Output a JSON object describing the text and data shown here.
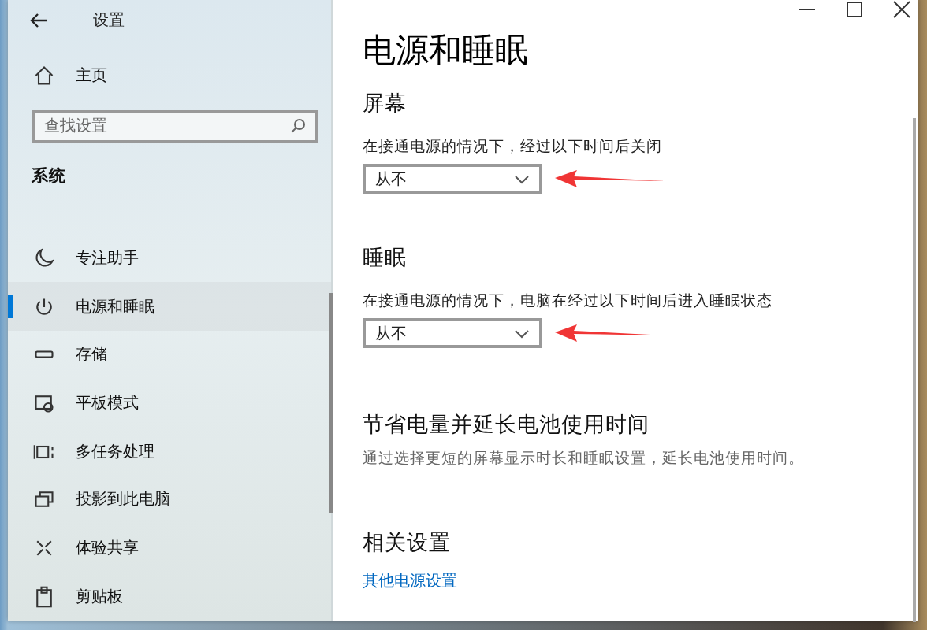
{
  "window": {
    "title": "设置"
  },
  "sidebar": {
    "home": "主页",
    "search": {
      "placeholder": "查找设置"
    },
    "section": "系统",
    "items": [
      {
        "label": "专注助手",
        "kind": "moon",
        "selected": false
      },
      {
        "label": "电源和睡眠",
        "kind": "power",
        "selected": true
      },
      {
        "label": "存储",
        "kind": "storage",
        "selected": false
      },
      {
        "label": "平板模式",
        "kind": "tablet",
        "selected": false
      },
      {
        "label": "多任务处理",
        "kind": "multitask",
        "selected": false
      },
      {
        "label": "投影到此电脑",
        "kind": "project",
        "selected": false
      },
      {
        "label": "体验共享",
        "kind": "share",
        "selected": false
      },
      {
        "label": "剪贴板",
        "kind": "clipboard",
        "selected": false
      }
    ]
  },
  "page": {
    "title": "电源和睡眠",
    "sections": [
      {
        "kind": "dropdown",
        "heading": "屏幕",
        "description": "在接通电源的情况下，经过以下时间后关闭",
        "value": "从不"
      },
      {
        "kind": "dropdown",
        "heading": "睡眠",
        "description": "在接通电源的情况下，电脑在经过以下时间后进入睡眠状态",
        "value": "从不"
      },
      {
        "kind": "text",
        "heading": "节省电量并延长电池使用时间",
        "description": "通过选择更短的屏幕显示时长和睡眠设置，延长电池使用时间。"
      },
      {
        "kind": "link",
        "heading": "相关设置",
        "link": "其他电源设置"
      }
    ]
  }
}
